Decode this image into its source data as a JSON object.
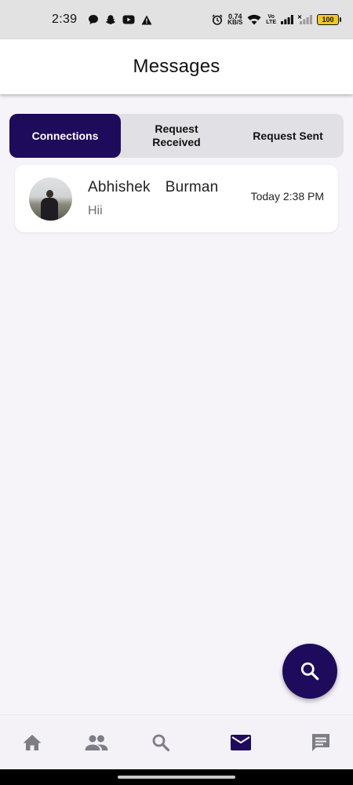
{
  "status_bar": {
    "time": "2:39",
    "net_speed_value": "0.74",
    "net_speed_unit": "KB/S",
    "volte_top": "Vo",
    "volte_bottom": "LTE",
    "battery": "100"
  },
  "header": {
    "title": "Messages"
  },
  "tabs": [
    {
      "label": "Connections",
      "active": true
    },
    {
      "label": "Request\nReceived",
      "active": false
    },
    {
      "label": "Request Sent",
      "active": false
    }
  ],
  "chats": [
    {
      "name": "Abhishek  Burman",
      "preview": "Hii",
      "time": "Today 2:38 PM"
    }
  ],
  "bottom_nav": {
    "items": [
      "home-icon",
      "people-icon",
      "search-icon",
      "mail-icon",
      "chat-icon"
    ],
    "active": "mail-icon"
  },
  "colors": {
    "accent": "#1e0b5c",
    "inactive_icon": "#7d7d85",
    "background": "#f6f4f9"
  }
}
